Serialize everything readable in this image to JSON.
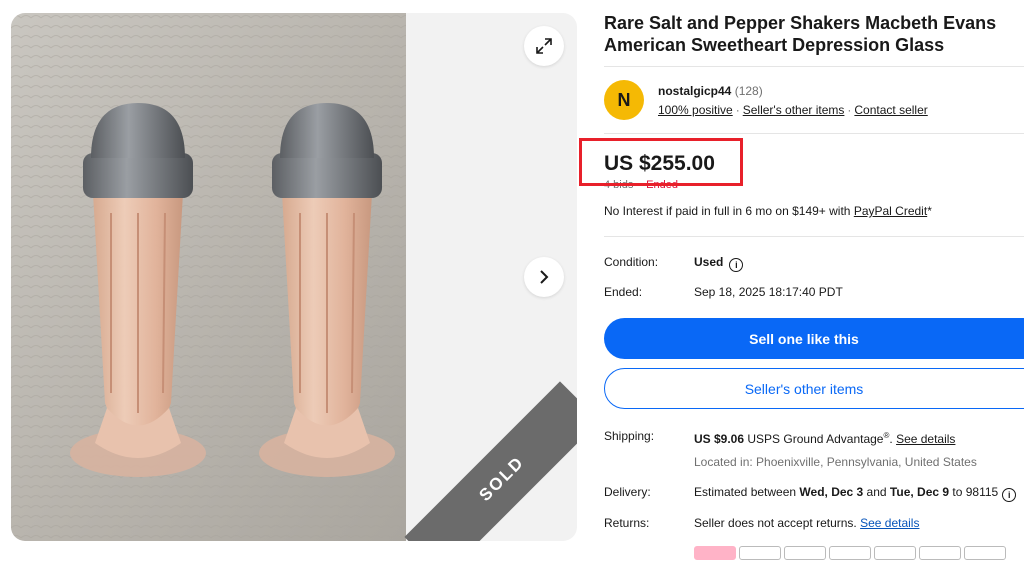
{
  "listing": {
    "title": "Rare Salt and Pepper Shakers Macbeth Evans American Sweetheart Depression Glass"
  },
  "gallery": {
    "sold_label": "SOLD",
    "expand_icon": "expand-icon",
    "next_icon": "chevron-right-icon"
  },
  "seller": {
    "avatar_letter": "N",
    "name": "nostalgicp44",
    "feedback_count": "(128)",
    "positive": "100% positive",
    "other_items": "Seller's other items",
    "contact": "Contact seller",
    "separator": "·"
  },
  "price": {
    "amount": "US $255.00",
    "bids": "4 bids",
    "sep": "·",
    "status": "Ended"
  },
  "financing": {
    "text": "No Interest if paid in full in 6 mo on $149+ with ",
    "link": "PayPal Credit",
    "suffix": "*"
  },
  "details": {
    "condition_label": "Condition:",
    "condition_value": "Used",
    "ended_label": "Ended:",
    "ended_value": "Sep 18, 2025 18:17:40 PDT"
  },
  "actions": {
    "sell_one": "Sell one like this",
    "sellers_items": "Seller's other items"
  },
  "shipping": {
    "label": "Shipping:",
    "cost": "US $9.06",
    "service": " USPS Ground Advantage",
    "reg": "®",
    "period": ". ",
    "details_link": "See details",
    "location": "Located in: Phoenixville, Pennsylvania, United States"
  },
  "delivery": {
    "label": "Delivery:",
    "prefix": "Estimated between ",
    "start": "Wed, Dec 3",
    "and": " and ",
    "end": "Tue, Dec 9",
    "suffix": " to 98115"
  },
  "returns": {
    "label": "Returns:",
    "text": "Seller does not accept returns. ",
    "link": "See details"
  },
  "colors": {
    "accent": "#0968f6",
    "highlight_box": "#e8202a",
    "avatar": "#f5b904"
  }
}
